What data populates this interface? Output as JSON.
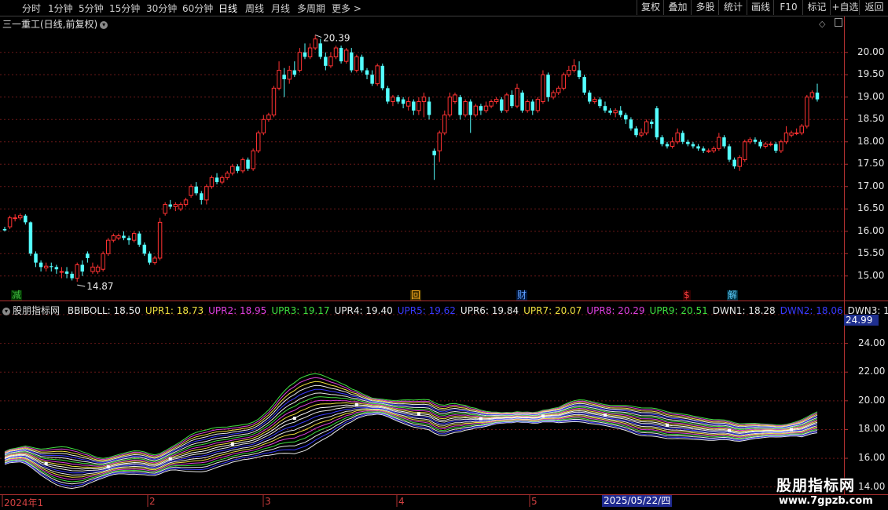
{
  "toolbar": {
    "periods": [
      {
        "label": "分时"
      },
      {
        "label": "1分钟"
      },
      {
        "label": "5分钟"
      },
      {
        "label": "15分钟"
      },
      {
        "label": "30分钟"
      },
      {
        "label": "60分钟"
      },
      {
        "label": "日线",
        "active": true
      },
      {
        "label": "周线"
      },
      {
        "label": "月线"
      },
      {
        "label": "多周期"
      },
      {
        "label": "更多 >"
      }
    ],
    "tools": [
      "复权",
      "叠加",
      "多股",
      "统计",
      "画线",
      "F10",
      "标记",
      "+自选",
      "返回"
    ]
  },
  "main_title": "三一重工(日线,前复权)",
  "indicator": {
    "name": "股朋指标网",
    "values": [
      {
        "label": "BBIBOLL: 18.50",
        "color": "#e8e8e8"
      },
      {
        "label": "UPR1: 18.73",
        "color": "#f0e040"
      },
      {
        "label": "UPR2: 18.95",
        "color": "#e040e0"
      },
      {
        "label": "UPR3: 19.17",
        "color": "#40e040"
      },
      {
        "label": "UPR4: 19.40",
        "color": "#e8e8e8"
      },
      {
        "label": "UPR5: 19.62",
        "color": "#3a3aff"
      },
      {
        "label": "UPR6: 19.84",
        "color": "#e8e8e8"
      },
      {
        "label": "UPR7: 20.07",
        "color": "#f0e040"
      },
      {
        "label": "UPR8: 20.29",
        "color": "#e040e0"
      },
      {
        "label": "UPR9: 20.51",
        "color": "#40e040"
      },
      {
        "label": "DWN1: 18.28",
        "color": "#e8e8e8"
      },
      {
        "label": "DWN2: 18.06",
        "color": "#3a3aff"
      },
      {
        "label": "DWN3: 17.83",
        "color": "#e8e8e8"
      }
    ],
    "current_value": "24.99"
  },
  "chart_data": {
    "type": "candlestick",
    "price_axis": [
      "20.00",
      "19.50",
      "19.00",
      "18.50",
      "18.00",
      "17.50",
      "17.00",
      "16.50",
      "16.00",
      "15.50",
      "15.00"
    ],
    "price_range": [
      14.68,
      20.61
    ],
    "high_label": "20.39",
    "low_label": "14.87",
    "indicator_axis": [
      "26.00",
      "24.00",
      "22.00",
      "20.00",
      "18.00",
      "16.00",
      "14.00"
    ],
    "indicator_range": [
      13.6,
      26.0
    ],
    "event_marks": [
      {
        "label": "减",
        "color": "#40c040",
        "bg": "#003300"
      },
      {
        "label": "回",
        "color": "#ffb020",
        "bg": "#403000"
      },
      {
        "label": "财",
        "color": "#60a0ff",
        "bg": "#001840"
      },
      {
        "label": "$",
        "color": "#ff4040",
        "bg": "#300000"
      },
      {
        "label": "解",
        "color": "#60d0ff",
        "bg": "#003040"
      }
    ],
    "months": [
      "2024年1",
      "2",
      "3",
      "4",
      "5"
    ],
    "date_tag": "2025/05/22/四",
    "candles": [
      [
        16.05,
        16.02,
        16.1,
        16.0
      ],
      [
        16.1,
        16.3,
        16.35,
        16.05
      ],
      [
        16.3,
        16.3,
        16.38,
        16.22
      ],
      [
        16.3,
        16.35,
        16.4,
        16.25
      ],
      [
        16.35,
        16.2,
        16.38,
        16.15
      ],
      [
        16.2,
        15.5,
        16.22,
        15.45
      ],
      [
        15.5,
        15.3,
        15.55,
        15.2
      ],
      [
        15.3,
        15.2,
        15.35,
        15.1
      ],
      [
        15.18,
        15.22,
        15.3,
        15.1
      ],
      [
        15.22,
        15.2,
        15.3,
        15.1
      ],
      [
        15.2,
        15.15,
        15.25,
        15.05
      ],
      [
        15.1,
        15.1,
        15.2,
        14.95
      ],
      [
        15.1,
        15.05,
        15.2,
        14.95
      ],
      [
        15.05,
        14.95,
        15.1,
        14.9
      ],
      [
        14.95,
        15.25,
        15.3,
        14.87
      ],
      [
        15.25,
        15.1,
        15.35,
        15.0
      ],
      [
        15.5,
        15.4,
        15.55,
        15.3
      ],
      [
        15.1,
        15.2,
        15.3,
        15.05
      ],
      [
        15.1,
        15.2,
        15.25,
        15.05
      ],
      [
        15.15,
        15.5,
        15.55,
        15.1
      ],
      [
        15.5,
        15.8,
        15.85,
        15.45
      ],
      [
        15.8,
        15.9,
        15.95,
        15.75
      ],
      [
        15.85,
        15.9,
        15.95,
        15.8
      ],
      [
        15.9,
        15.85,
        16.0,
        15.8
      ],
      [
        15.85,
        15.8,
        15.9,
        15.7
      ],
      [
        15.8,
        15.95,
        16.0,
        15.75
      ],
      [
        15.95,
        15.7,
        16.0,
        15.65
      ],
      [
        15.7,
        15.5,
        15.75,
        15.45
      ],
      [
        15.5,
        15.3,
        15.55,
        15.25
      ],
      [
        15.3,
        15.4,
        15.45,
        15.25
      ],
      [
        15.4,
        16.2,
        16.3,
        15.35
      ],
      [
        16.4,
        16.6,
        16.65,
        16.35
      ],
      [
        16.6,
        16.55,
        16.7,
        16.5
      ],
      [
        16.55,
        16.6,
        16.65,
        16.45
      ],
      [
        16.5,
        16.6,
        16.65,
        16.45
      ],
      [
        16.6,
        16.7,
        16.75,
        16.55
      ],
      [
        16.8,
        17.0,
        17.05,
        16.75
      ],
      [
        17.0,
        16.85,
        17.1,
        16.8
      ],
      [
        16.85,
        16.7,
        16.9,
        16.6
      ],
      [
        16.7,
        17.0,
        17.05,
        16.6
      ],
      [
        17.0,
        17.2,
        17.25,
        16.95
      ],
      [
        17.2,
        17.1,
        17.3,
        17.05
      ],
      [
        17.1,
        17.2,
        17.25,
        17.05
      ],
      [
        17.2,
        17.3,
        17.35,
        17.15
      ],
      [
        17.3,
        17.45,
        17.5,
        17.25
      ],
      [
        17.45,
        17.35,
        17.5,
        17.3
      ],
      [
        17.35,
        17.6,
        17.65,
        17.3
      ],
      [
        17.6,
        17.4,
        17.65,
        17.35
      ],
      [
        17.4,
        17.8,
        17.85,
        17.35
      ],
      [
        17.8,
        18.2,
        18.25,
        17.75
      ],
      [
        18.2,
        18.5,
        18.6,
        18.15
      ],
      [
        18.5,
        18.6,
        18.65,
        18.45
      ],
      [
        18.6,
        19.2,
        19.25,
        18.55
      ],
      [
        19.2,
        19.6,
        19.8,
        19.15
      ],
      [
        19.5,
        19.4,
        19.65,
        19.0
      ],
      [
        19.4,
        19.6,
        19.7,
        19.3
      ],
      [
        19.6,
        19.5,
        19.8,
        19.45
      ],
      [
        19.6,
        20.0,
        20.1,
        19.55
      ],
      [
        20.0,
        19.9,
        20.2,
        19.85
      ],
      [
        19.9,
        20.1,
        20.2,
        19.85
      ],
      [
        20.1,
        20.3,
        20.39,
        20.05
      ],
      [
        20.2,
        19.9,
        20.3,
        19.85
      ],
      [
        19.9,
        19.7,
        20.0,
        19.6
      ],
      [
        19.7,
        19.9,
        20.0,
        19.65
      ],
      [
        19.9,
        20.1,
        20.15,
        19.85
      ],
      [
        20.1,
        19.8,
        20.15,
        19.75
      ],
      [
        19.8,
        20.05,
        20.1,
        19.75
      ],
      [
        20.0,
        19.6,
        20.1,
        19.55
      ],
      [
        19.6,
        19.9,
        19.95,
        19.55
      ],
      [
        19.9,
        19.6,
        19.95,
        19.55
      ],
      [
        19.6,
        19.5,
        19.65,
        19.4
      ],
      [
        19.5,
        19.3,
        19.6,
        19.25
      ],
      [
        19.3,
        19.7,
        19.75,
        19.25
      ],
      [
        19.7,
        19.2,
        19.75,
        19.15
      ],
      [
        19.2,
        18.9,
        19.25,
        18.85
      ],
      [
        18.9,
        19.0,
        19.05,
        18.8
      ],
      [
        19.0,
        18.9,
        19.05,
        18.85
      ],
      [
        18.95,
        18.85,
        19.0,
        18.75
      ],
      [
        18.8,
        18.9,
        19.0,
        18.7
      ],
      [
        18.9,
        18.7,
        18.95,
        18.6
      ],
      [
        18.7,
        18.9,
        19.0,
        18.6
      ],
      [
        18.9,
        19.0,
        19.1,
        18.55
      ],
      [
        18.9,
        18.6,
        19.0,
        18.5
      ],
      [
        17.8,
        17.7,
        17.85,
        17.15
      ],
      [
        17.8,
        18.2,
        18.25,
        17.55
      ],
      [
        18.2,
        18.6,
        18.7,
        18.15
      ],
      [
        18.6,
        19.0,
        19.1,
        18.55
      ],
      [
        18.9,
        19.05,
        19.1,
        18.85
      ],
      [
        19.0,
        18.6,
        19.05,
        18.5
      ],
      [
        18.6,
        18.9,
        18.95,
        18.55
      ],
      [
        18.9,
        18.6,
        18.95,
        18.2
      ],
      [
        18.6,
        18.8,
        18.85,
        18.55
      ],
      [
        18.8,
        18.7,
        18.85,
        18.6
      ],
      [
        18.7,
        18.8,
        18.9,
        18.65
      ],
      [
        18.8,
        18.9,
        18.95,
        18.75
      ],
      [
        18.9,
        18.95,
        19.0,
        18.85
      ],
      [
        18.95,
        18.7,
        19.0,
        18.65
      ],
      [
        18.7,
        19.05,
        19.1,
        18.65
      ],
      [
        19.05,
        18.8,
        19.15,
        18.75
      ],
      [
        18.8,
        19.2,
        19.3,
        18.75
      ],
      [
        19.1,
        18.7,
        19.15,
        18.65
      ],
      [
        18.7,
        18.9,
        18.95,
        18.65
      ],
      [
        18.9,
        18.7,
        18.95,
        18.6
      ],
      [
        18.7,
        18.95,
        19.0,
        18.65
      ],
      [
        18.9,
        19.5,
        19.6,
        18.85
      ],
      [
        19.5,
        19.0,
        19.55,
        18.9
      ],
      [
        19.0,
        19.1,
        19.15,
        18.95
      ],
      [
        19.1,
        19.2,
        19.25,
        19.05
      ],
      [
        19.2,
        19.5,
        19.55,
        19.15
      ],
      [
        19.5,
        19.6,
        19.7,
        19.45
      ],
      [
        19.6,
        19.7,
        19.85,
        19.55
      ],
      [
        19.6,
        19.45,
        19.8,
        19.4
      ],
      [
        19.45,
        19.1,
        19.5,
        19.05
      ],
      [
        19.1,
        18.9,
        19.15,
        18.85
      ],
      [
        18.9,
        18.95,
        19.0,
        18.85
      ],
      [
        18.95,
        18.8,
        19.0,
        18.75
      ],
      [
        18.8,
        18.7,
        18.9,
        18.65
      ],
      [
        18.7,
        18.65,
        18.75,
        18.6
      ],
      [
        18.65,
        18.7,
        18.75,
        18.55
      ],
      [
        18.7,
        18.6,
        18.8,
        18.55
      ],
      [
        18.6,
        18.5,
        18.65,
        18.4
      ],
      [
        18.5,
        18.3,
        18.55,
        18.25
      ],
      [
        18.3,
        18.15,
        18.35,
        18.1
      ],
      [
        18.15,
        18.2,
        18.3,
        18.1
      ],
      [
        18.2,
        18.45,
        18.5,
        18.15
      ],
      [
        18.45,
        18.4,
        18.5,
        18.3
      ],
      [
        18.75,
        18.1,
        18.8,
        18.05
      ],
      [
        18.1,
        17.95,
        18.15,
        17.9
      ],
      [
        17.95,
        17.9,
        18.0,
        17.85
      ],
      [
        17.9,
        18.0,
        18.1,
        17.85
      ],
      [
        18.0,
        18.2,
        18.3,
        17.95
      ],
      [
        18.2,
        18.0,
        18.25,
        17.95
      ],
      [
        18.0,
        17.95,
        18.05,
        17.9
      ],
      [
        17.95,
        17.9,
        18.0,
        17.85
      ],
      [
        17.9,
        17.85,
        17.95,
        17.8
      ],
      [
        17.85,
        17.8,
        17.9,
        17.75
      ],
      [
        17.8,
        17.8,
        17.85,
        17.75
      ],
      [
        17.8,
        17.85,
        17.9,
        17.75
      ],
      [
        17.85,
        18.1,
        18.2,
        17.8
      ],
      [
        18.1,
        17.9,
        18.15,
        17.85
      ],
      [
        17.9,
        17.6,
        17.95,
        17.55
      ],
      [
        17.6,
        17.45,
        17.65,
        17.4
      ],
      [
        17.45,
        17.65,
        17.7,
        17.35
      ],
      [
        17.6,
        18.0,
        18.05,
        17.55
      ],
      [
        18.0,
        18.05,
        18.1,
        17.95
      ],
      [
        18.05,
        18.0,
        18.1,
        17.95
      ],
      [
        18.0,
        17.9,
        18.05,
        17.85
      ],
      [
        17.9,
        17.95,
        18.0,
        17.85
      ],
      [
        17.95,
        17.95,
        18.0,
        17.9
      ],
      [
        17.95,
        17.8,
        18.0,
        17.75
      ],
      [
        17.8,
        18.0,
        18.05,
        17.75
      ],
      [
        18.0,
        18.2,
        18.35,
        17.95
      ],
      [
        18.15,
        18.2,
        18.25,
        18.1
      ],
      [
        18.2,
        18.2,
        18.3,
        18.15
      ],
      [
        18.2,
        18.35,
        18.4,
        18.15
      ],
      [
        18.35,
        19.0,
        19.05,
        18.3
      ],
      [
        19.0,
        19.1,
        19.15,
        18.95
      ],
      [
        19.1,
        18.95,
        19.3,
        18.9
      ]
    ]
  }
}
